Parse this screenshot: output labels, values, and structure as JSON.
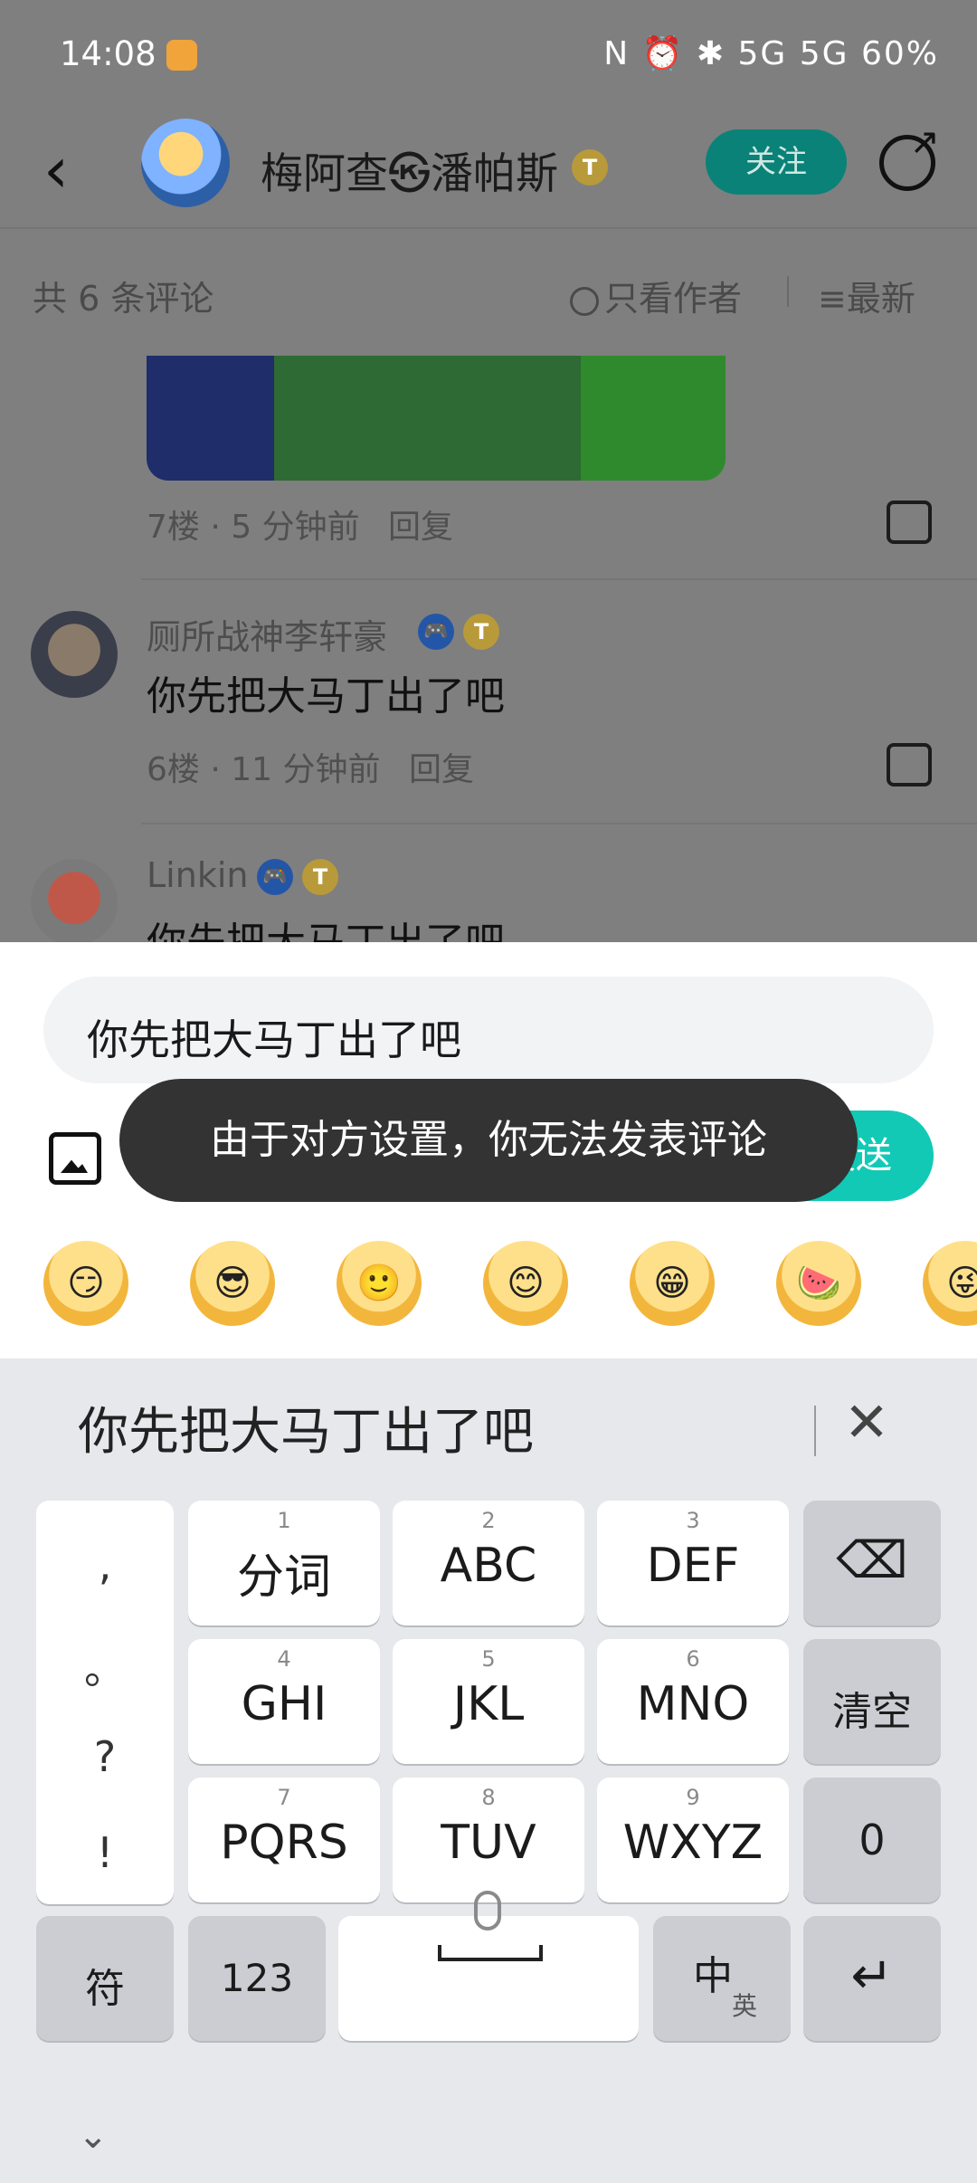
{
  "status_bar": {
    "time": "14:08",
    "icons": "N ⏰ ✱ 5G 5G",
    "battery": "60%"
  },
  "header": {
    "author_name": "梅阿查㉿潘帕斯",
    "follow_label": "关注",
    "badge_label": "T"
  },
  "filter": {
    "count_label": "共 6 条评论",
    "author_only_label": "只看作者",
    "sort_label": "最新"
  },
  "comments": [
    {
      "floor_meta": "7楼 · 5 分钟前",
      "reply_label": "回复"
    },
    {
      "name": "厕所战神李轩豪",
      "text": "你先把大马丁出了吧",
      "floor_meta": "6楼 · 11 分钟前",
      "reply_label": "回复"
    },
    {
      "name": "Linkin",
      "text": "你先把大马丁出了吧"
    }
  ],
  "input": {
    "value": "你先把大马丁出了吧",
    "send_label": "发送"
  },
  "toast": {
    "message": "由于对方设置，你无法发表评论"
  },
  "keyboard": {
    "candidate": "你先把大马丁出了吧",
    "punct": [
      ",",
      "。",
      "?",
      "!"
    ],
    "keys": [
      {
        "num": "1",
        "label": "分词"
      },
      {
        "num": "2",
        "label": "ABC"
      },
      {
        "num": "3",
        "label": "DEF"
      },
      {
        "num": "4",
        "label": "GHI"
      },
      {
        "num": "5",
        "label": "JKL"
      },
      {
        "num": "6",
        "label": "MNO"
      },
      {
        "num": "7",
        "label": "PQRS"
      },
      {
        "num": "8",
        "label": "TUV"
      },
      {
        "num": "9",
        "label": "WXYZ"
      }
    ],
    "clear_label": "清空",
    "zero_label": "0",
    "symbol_label": "符",
    "num_label": "123",
    "lang_label": "中",
    "lang_sub": "英",
    "backspace_icon": "⌫",
    "enter_icon": "↵"
  }
}
